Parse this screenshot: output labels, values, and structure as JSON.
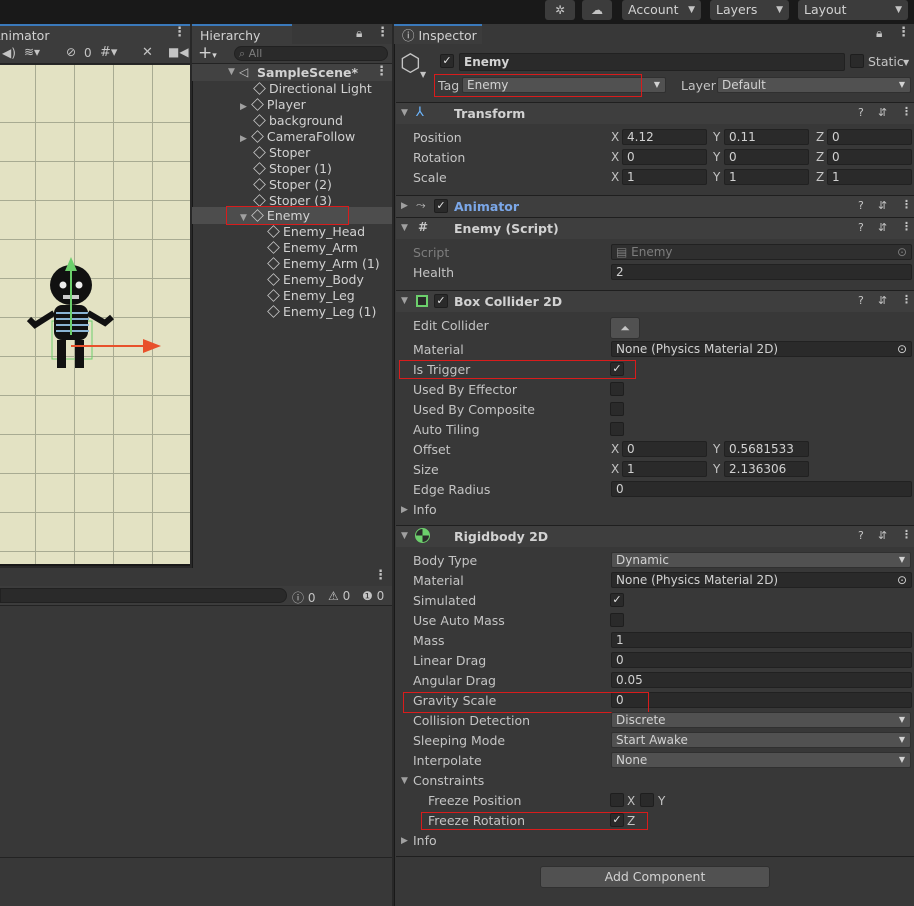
{
  "toolbar": {
    "account_label": "Account",
    "layers_label": "Layers",
    "layout_label": "Layout"
  },
  "tabs": {
    "animator": "Animator",
    "hierarchy": "Hierarchy",
    "inspector": "Inspector"
  },
  "scene_toolbar": {
    "hidden_count": "0"
  },
  "hierarchy": {
    "search_placeholder": "All",
    "scene_name": "SampleScene*",
    "items": [
      {
        "label": "Directional Light"
      },
      {
        "label": "Player"
      },
      {
        "label": "background"
      },
      {
        "label": "CameraFollow"
      },
      {
        "label": "Stoper"
      },
      {
        "label": "Stoper (1)"
      },
      {
        "label": "Stoper (2)"
      },
      {
        "label": "Stoper (3)"
      },
      {
        "label": "Enemy"
      },
      {
        "label": "Enemy_Head"
      },
      {
        "label": "Enemy_Arm"
      },
      {
        "label": "Enemy_Arm (1)"
      },
      {
        "label": "Enemy_Body"
      },
      {
        "label": "Enemy_Leg"
      },
      {
        "label": "Enemy_Leg (1)"
      }
    ]
  },
  "console": {
    "log_count": "0",
    "warning_count": "0",
    "error_count": "0"
  },
  "inspector": {
    "object_name": "Enemy",
    "static_label": "Static",
    "tag_label": "Tag",
    "tag_value": "Enemy",
    "layer_label": "Layer",
    "layer_value": "Default",
    "transform": {
      "title": "Transform",
      "position_label": "Position",
      "rotation_label": "Rotation",
      "scale_label": "Scale",
      "axis_x": "X",
      "axis_y": "Y",
      "axis_z": "Z",
      "position": {
        "x": "4.12",
        "y": "0.11",
        "z": "0"
      },
      "rotation": {
        "x": "0",
        "y": "0",
        "z": "0"
      },
      "scale": {
        "x": "1",
        "y": "1",
        "z": "1"
      }
    },
    "animator": {
      "title": "Animator"
    },
    "enemy_script": {
      "title": "Enemy (Script)",
      "script_label": "Script",
      "script_value": "Enemy",
      "health_label": "Health",
      "health_value": "2"
    },
    "box_collider": {
      "title": "Box Collider 2D",
      "edit_collider_label": "Edit Collider",
      "material_label": "Material",
      "material_value": "None (Physics Material 2D)",
      "is_trigger_label": "Is Trigger",
      "used_by_effector_label": "Used By Effector",
      "used_by_composite_label": "Used By Composite",
      "auto_tiling_label": "Auto Tiling",
      "offset_label": "Offset",
      "offset": {
        "x": "0",
        "y": "0.5681533"
      },
      "size_label": "Size",
      "size": {
        "x": "1",
        "y": "2.136306"
      },
      "edge_radius_label": "Edge Radius",
      "edge_radius_value": "0",
      "info_label": "Info"
    },
    "rigidbody": {
      "title": "Rigidbody 2D",
      "body_type_label": "Body Type",
      "body_type_value": "Dynamic",
      "material_label": "Material",
      "material_value": "None (Physics Material 2D)",
      "simulated_label": "Simulated",
      "use_auto_mass_label": "Use Auto Mass",
      "mass_label": "Mass",
      "mass_value": "1",
      "linear_drag_label": "Linear Drag",
      "linear_drag_value": "0",
      "angular_drag_label": "Angular Drag",
      "angular_drag_value": "0.05",
      "gravity_scale_label": "Gravity Scale",
      "gravity_scale_value": "0",
      "collision_detection_label": "Collision Detection",
      "collision_detection_value": "Discrete",
      "sleeping_mode_label": "Sleeping Mode",
      "sleeping_mode_value": "Start Awake",
      "interpolate_label": "Interpolate",
      "interpolate_value": "None",
      "constraints_label": "Constraints",
      "freeze_position_label": "Freeze Position",
      "freeze_rotation_label": "Freeze Rotation",
      "axis_x": "X",
      "axis_y": "Y",
      "axis_z": "Z",
      "info_label": "Info"
    },
    "add_component_label": "Add Component"
  },
  "colors": {
    "highlight_red": "#d81c1c",
    "selection": "#4d4d4d",
    "scene_bg": "#e3e2c3",
    "animator_blue": "#7ba7e8"
  }
}
